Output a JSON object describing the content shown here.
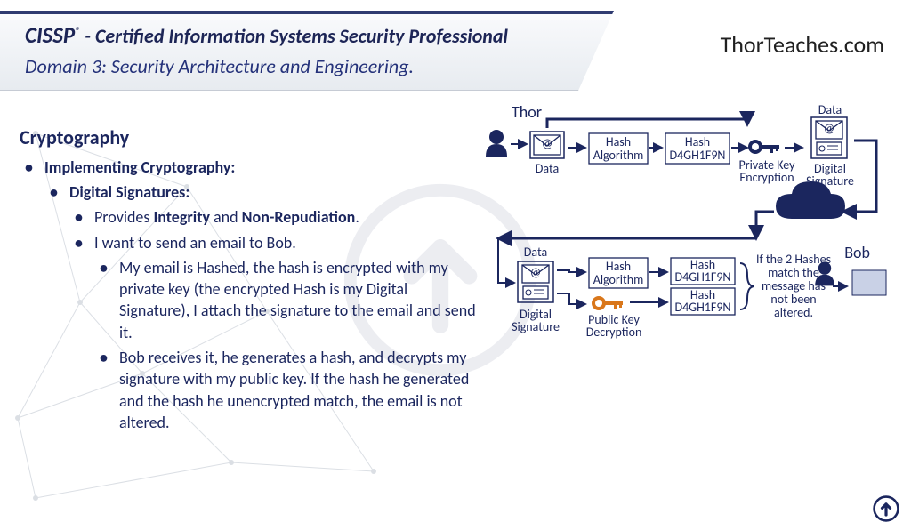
{
  "header": {
    "title_prefix": "CISSP",
    "reg": "®",
    "title_suffix": " - Certified Information Systems Security Professional",
    "domain": "Domain 3: Security Architecture and Engineering.",
    "brand": "ThorTeaches.com"
  },
  "content": {
    "heading": "Cryptography",
    "l1": "Implementing Cryptography:",
    "l2": "Digital Signatures:",
    "p1a": "Provides ",
    "p1b": "Integrity",
    "p1c": " and ",
    "p1d": "Non-Repudiation",
    "p1e": ".",
    "p2": "I want to send an email to Bob.",
    "p3": "My email is Hashed, the hash is encrypted with my private key (the encrypted Hash is my Digital Signature), I attach the signature to the email and send it.",
    "p4": "Bob receives it, he generates a hash, and decrypts my signature with my public key. If the hash he generated and the hash he unencrypted match, the email is not altered."
  },
  "diagram": {
    "thor": "Thor",
    "bob": "Bob",
    "data": "Data",
    "hash_algo_l1": "Hash",
    "hash_algo_l2": "Algorithm",
    "hash_val": "D4GH1F9N",
    "hash_word": "Hash",
    "priv": "Private Key",
    "encryption": "Encryption",
    "digsig_l1": "Digital",
    "digsig_l2": "Signature",
    "pub": "Public Key",
    "decryption": "Decryption",
    "match_l1": "If the 2 Hashes",
    "match_l2": "match the",
    "match_l3": "message has",
    "match_l4": "not been",
    "match_l5": "altered."
  }
}
